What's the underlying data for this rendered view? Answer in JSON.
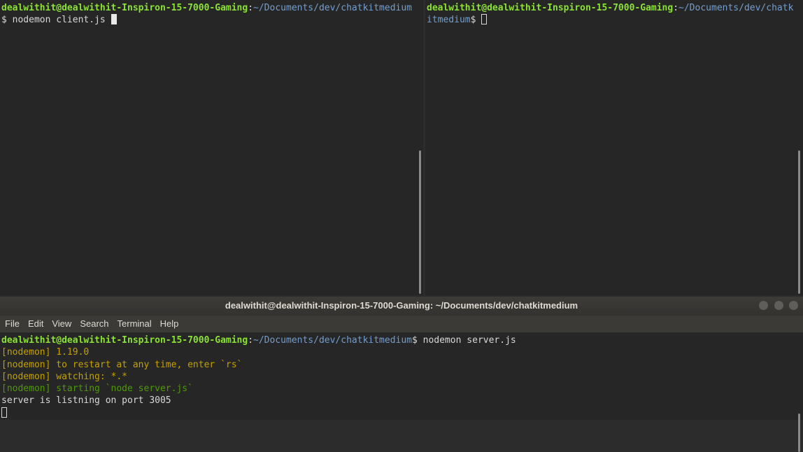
{
  "left_pane": {
    "user_host": "dealwithit@dealwithit-Inspiron-15-7000-Gaming",
    "colon": ":",
    "path": "~/Documents/dev/chatkitmedium",
    "prompt_symbol": "$ ",
    "command": "nodemon client.js "
  },
  "right_pane": {
    "user_host": "dealwithit@dealwithit-Inspiron-15-7000-Gaming",
    "colon": ":",
    "path": "~/Documents/dev/chatkitmedium",
    "prompt_symbol": "$ "
  },
  "bottom_window": {
    "title": "dealwithit@dealwithit-Inspiron-15-7000-Gaming: ~/Documents/dev/chatkitmedium",
    "menu": [
      "File",
      "Edit",
      "View",
      "Search",
      "Terminal",
      "Help"
    ],
    "prompt": {
      "user_host": "dealwithit@dealwithit-Inspiron-15-7000-Gaming",
      "colon": ":",
      "path": "~/Documents/dev/chatkitmedium",
      "prompt_symbol": "$ ",
      "command": "nodemon server.js"
    },
    "output": [
      "[nodemon] 1.19.0",
      "[nodemon] to restart at any time, enter `rs`",
      "[nodemon] watching: *.*",
      "[nodemon] starting `node server.js`",
      "server is listning on port 3005"
    ]
  },
  "colors": {
    "user_host": "#8ae234",
    "path": "#729fcf",
    "nodemon_yellow": "#c4a000",
    "nodemon_green": "#4e9a06",
    "background": "#262626"
  }
}
